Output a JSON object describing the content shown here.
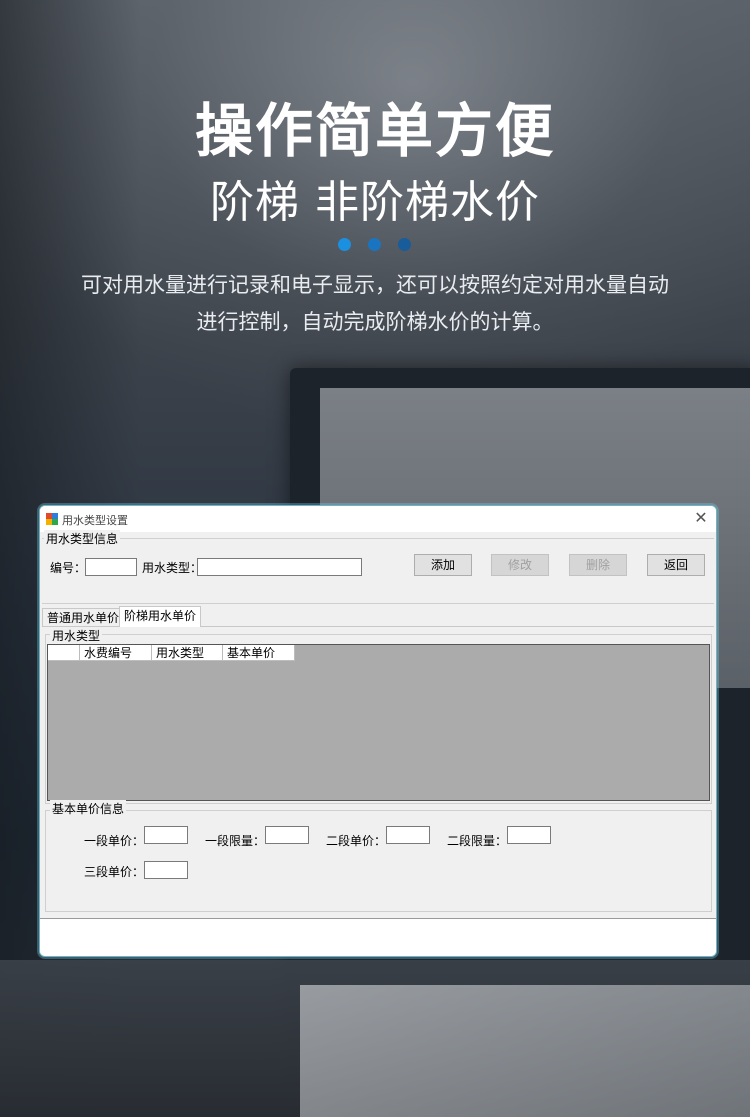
{
  "hero": {
    "title": "操作简单方便",
    "subtitle": "阶梯  非阶梯水价",
    "dot_colors": [
      "#1b8fe0",
      "#1a74c0",
      "#195c9a"
    ],
    "description_line1": "可对用水量进行记录和电子显示，还可以按照约定对用水量自动",
    "description_line2": "进行控制，自动完成阶梯水价的计算。"
  },
  "dialog": {
    "title": "用水类型设置",
    "info_group": {
      "title": "用水类型信息",
      "id_label": "编号：",
      "id_value": "",
      "type_label": "用水类型：",
      "type_value": ""
    },
    "buttons": {
      "add": "添加",
      "edit": "修改",
      "delete": "删除",
      "back": "返回"
    },
    "tabs": [
      "普通用水单价",
      "阶梯用水单价"
    ],
    "list_group": {
      "title": "用水类型",
      "columns": [
        "",
        "水费编号",
        "用水类型",
        "基本单价"
      ],
      "rows": []
    },
    "price_group": {
      "title": "基本单价信息",
      "tier1_price_label": "一段单价：",
      "tier1_limit_label": "一段限量：",
      "tier2_price_label": "二段单价：",
      "tier2_limit_label": "二段限量：",
      "tier3_price_label": "三段单价："
    }
  }
}
